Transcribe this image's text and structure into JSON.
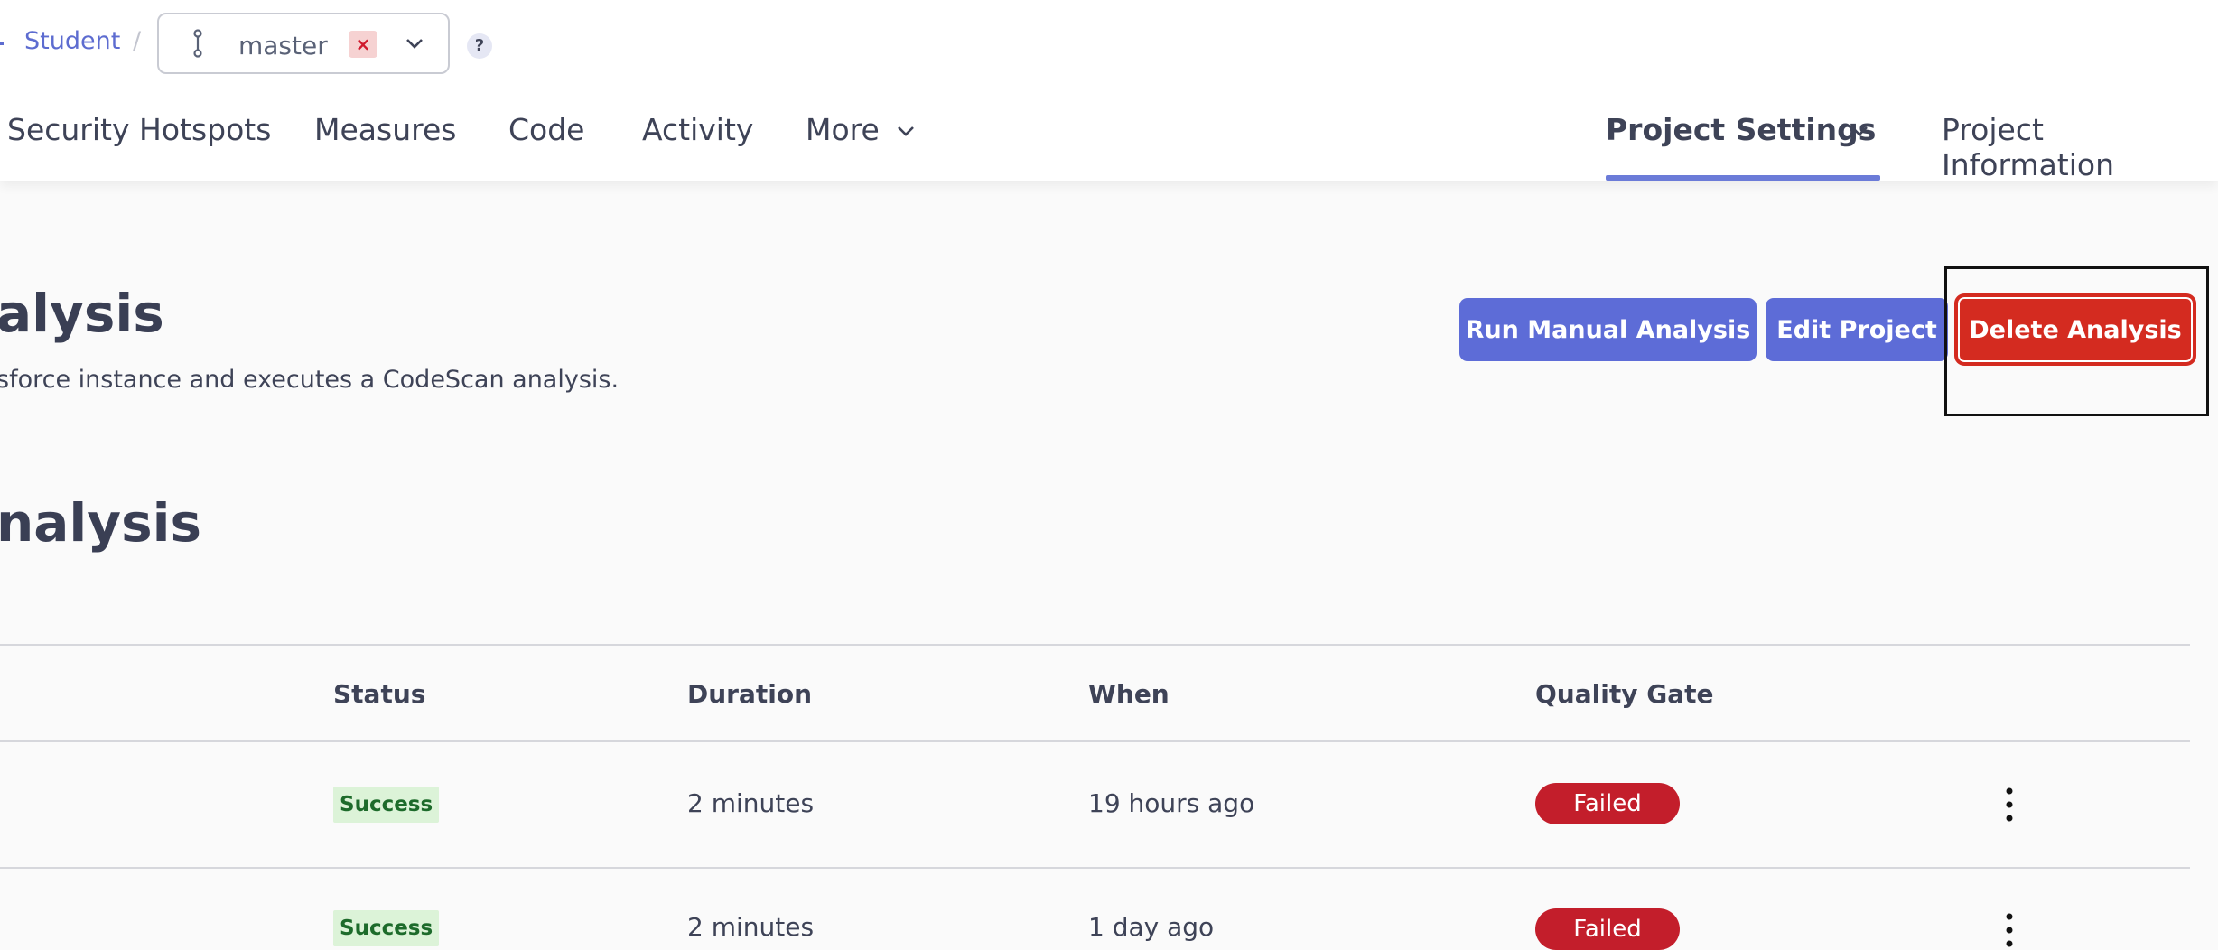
{
  "breadcrumb": {
    "project": "Student",
    "separator": "/"
  },
  "branch": {
    "name": "master",
    "remove_label": "×",
    "icon": "branch-icon"
  },
  "help": {
    "label": "?"
  },
  "nav": {
    "security_hotspots": "Security Hotspots",
    "measures": "Measures",
    "code": "Code",
    "activity": "Activity",
    "more": "More",
    "project_settings": "Project Settings",
    "project_information": "Project Information"
  },
  "page": {
    "title": "alysis",
    "description": "sforce instance and executes a CodeScan analysis.",
    "section_title": "nalysis"
  },
  "actions": {
    "run_manual_analysis": "Run Manual Analysis",
    "edit_project": "Edit Project",
    "delete_analysis": "Delete Analysis"
  },
  "table": {
    "headers": {
      "status": "Status",
      "duration": "Duration",
      "when": "When",
      "quality_gate": "Quality Gate"
    },
    "rows": [
      {
        "status": "Success",
        "duration": "2 minutes",
        "when": "19 hours ago",
        "quality_gate": "Failed"
      },
      {
        "status": "Success",
        "duration": "2 minutes",
        "when": "1 day ago",
        "quality_gate": "Failed"
      }
    ]
  },
  "colors": {
    "accent": "#5d6cd7",
    "danger": "#d42b20",
    "failed_badge": "#c31e2b",
    "success_badge_bg": "#dcf3d8",
    "success_badge_text": "#1d6b2b"
  }
}
